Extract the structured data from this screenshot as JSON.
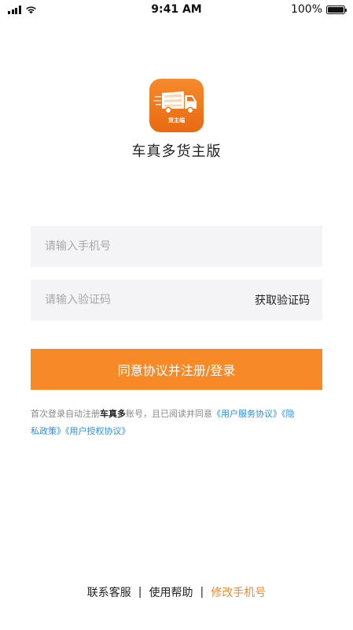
{
  "status_bar": {
    "time": "9:41 AM",
    "battery": "100%"
  },
  "app": {
    "name": "车真多货主版",
    "badge": "货主端",
    "accent_color": "#f78a27"
  },
  "form": {
    "phone_placeholder": "请输入手机号",
    "code_placeholder": "请输入验证码",
    "get_code_label": "获取验证码",
    "submit_label": "同意协议并注册/登录"
  },
  "agreement": {
    "prefix": "首次登录自动注册",
    "brand": "车真多",
    "middle": "账号，且已阅读并同意",
    "links": [
      "《用户服务协议》",
      "《隐私政策》",
      "《用户授权协议》"
    ]
  },
  "footer": {
    "links": [
      "联系客服",
      "使用帮助",
      "修改手机号"
    ],
    "separator": "|"
  },
  "icons": [
    "signal-icon",
    "wifi-icon",
    "battery-icon",
    "truck-icon"
  ]
}
